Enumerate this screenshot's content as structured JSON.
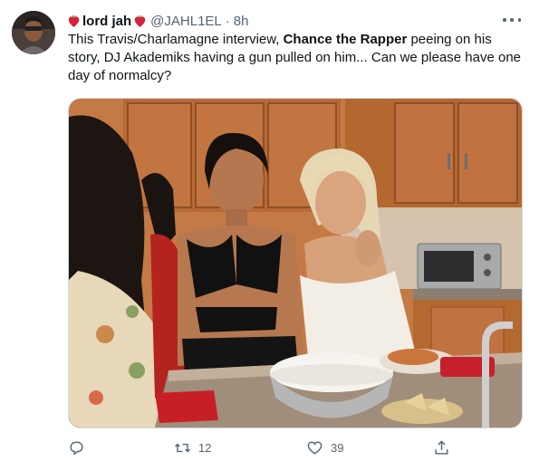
{
  "author": {
    "name": "lord jah",
    "handle": "@JAHL1EL",
    "separator": "·",
    "time": "8h"
  },
  "tweet": {
    "text_before": "This Travis/Charlamagne interview, ",
    "text_bold": "Chance the Rapper",
    "text_after": " peeing on his story, DJ Akademiks having a gun pulled on him... Can we please have one day of normalcy?"
  },
  "actions": {
    "reply_count": "",
    "retweet_count": "12",
    "like_count": "39"
  },
  "icons": {
    "name_emoji": "heart-emoji-icon",
    "more": "more-dots-icon",
    "reply": "reply-icon",
    "retweet": "retweet-icon",
    "like": "like-icon",
    "share": "share-icon"
  },
  "colors": {
    "text": "#0f1419",
    "secondary": "#536471",
    "border": "#cfd9de"
  }
}
